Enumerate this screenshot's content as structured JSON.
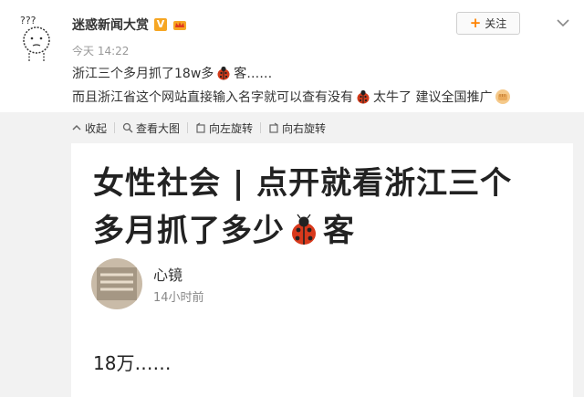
{
  "post": {
    "author": "迷惑新闻大赏",
    "verified_badge": "V",
    "time": "今天 14:22",
    "follow_label": "关注",
    "line1_a": "浙江三个多月抓了18w多",
    "line1_b": "客……",
    "line2_a": "而且浙江省这个网站直接输入名字就可以查有没有",
    "line2_b": " 太牛了 建议全国推广"
  },
  "toolbar": {
    "collapse": "收起",
    "view_large": "查看大图",
    "rotate_left": "向左旋转",
    "rotate_right": "向右旋转"
  },
  "article": {
    "title_line1": "女性社会 | 点开就看浙江三个",
    "title_line2_a": "多月抓了多少",
    "title_line2_b": "客",
    "author": "心镜",
    "time": "14小时前",
    "body": "18万……"
  },
  "colors": {
    "accent": "#ff8200",
    "badge": "#f6a623",
    "toolbar_bg": "#f2f2f2"
  },
  "icons": [
    "avatar-doodle",
    "v-badge",
    "crown-icon",
    "chevron-down-icon",
    "ladybug-icon",
    "fist-icon",
    "collapse-icon",
    "zoom-icon",
    "rotate-left-icon",
    "rotate-right-icon"
  ]
}
